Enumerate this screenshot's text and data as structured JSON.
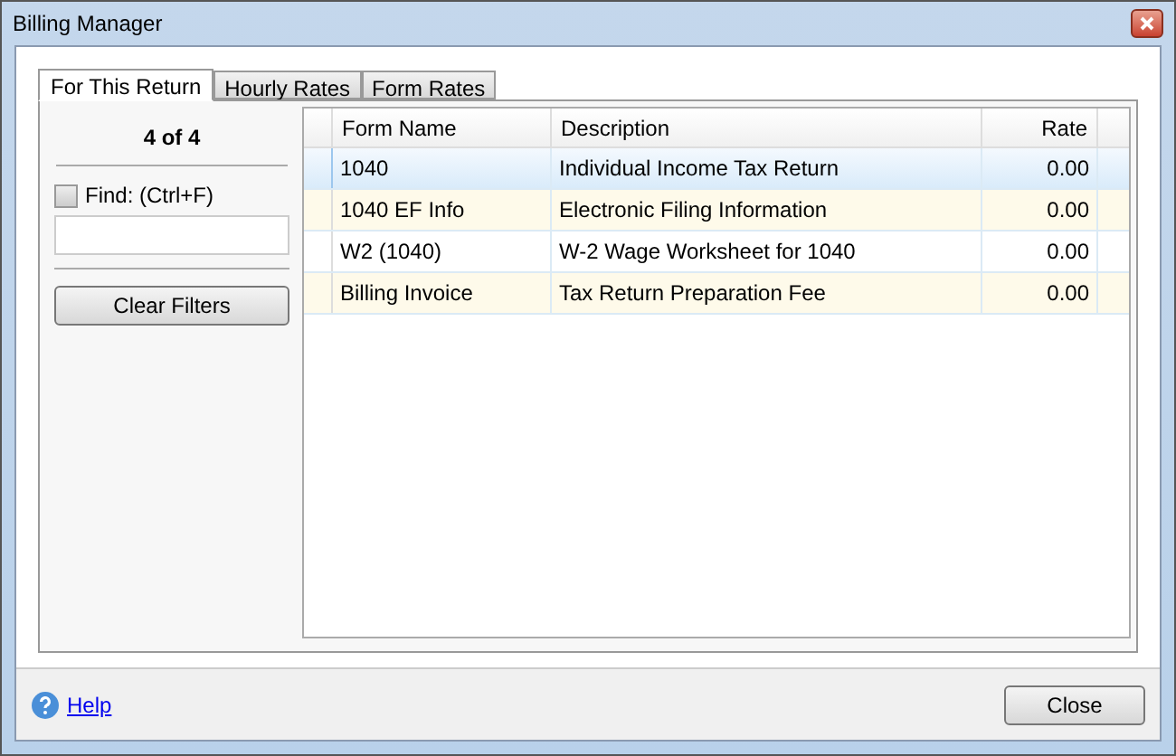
{
  "window": {
    "title": "Billing Manager"
  },
  "tabs": [
    {
      "label": "For This Return",
      "selected": true
    },
    {
      "label": "Hourly Rates",
      "selected": false
    },
    {
      "label": "Form Rates",
      "selected": false
    }
  ],
  "filter": {
    "count": "4 of 4",
    "find_label": "Find: (Ctrl+F)",
    "find_checked": false,
    "clear_button": "Clear Filters"
  },
  "table": {
    "columns": [
      "Form Name",
      "Description",
      "Rate"
    ],
    "rows": [
      {
        "cells": [
          "1040",
          "Individual Income Tax Return",
          "0.00"
        ],
        "selected": true
      },
      {
        "cells": [
          "1040 EF Info",
          "Electronic Filing Information",
          "0.00"
        ],
        "selected": false
      },
      {
        "cells": [
          "W2 (1040)",
          "W-2 Wage Worksheet for 1040",
          "0.00"
        ],
        "selected": false
      },
      {
        "cells": [
          "Billing Invoice",
          "Tax Return Preparation Fee",
          "0.00"
        ],
        "selected": false
      }
    ]
  },
  "footer": {
    "help_link": "Help",
    "close_button": "Close"
  }
}
